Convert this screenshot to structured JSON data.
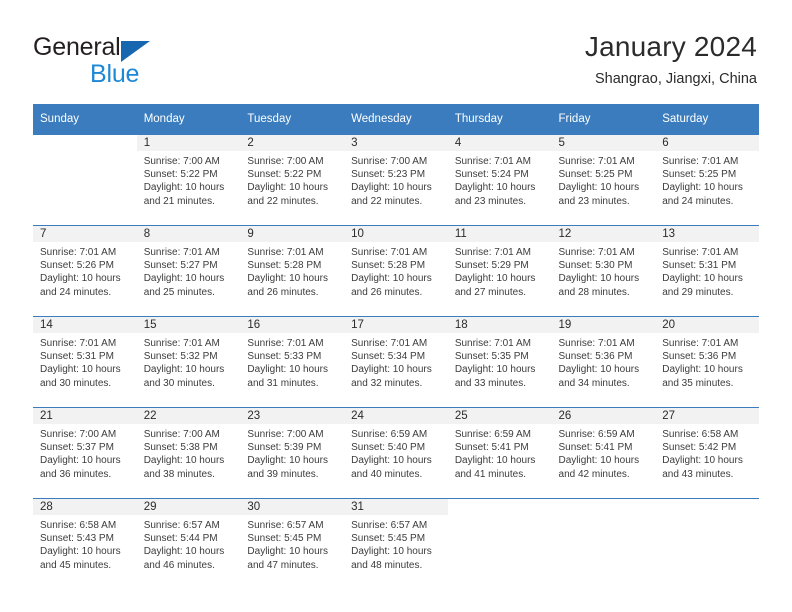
{
  "brand": {
    "name_part1": "General",
    "name_part2": "Blue",
    "triangle_icon": "triangle-icon",
    "color_dark": "#231f20",
    "color_blue": "#1e87d6",
    "color_triangle": "#1666b0"
  },
  "header": {
    "title": "January 2024",
    "subtitle": "Shangrao, Jiangxi, China"
  },
  "theme": {
    "header_bg": "#3a7cbe",
    "header_text": "#ffffff",
    "daynum_band_bg": "#f2f2f2",
    "cell_bg": "#ffffff",
    "text": "#2b2b2b"
  },
  "weekdays": [
    "Sunday",
    "Monday",
    "Tuesday",
    "Wednesday",
    "Thursday",
    "Friday",
    "Saturday"
  ],
  "weeks": [
    [
      {
        "day": "",
        "sunrise": "",
        "sunset": "",
        "daylight1": "",
        "daylight2": "",
        "blank": true
      },
      {
        "day": "1",
        "sunrise": "Sunrise: 7:00 AM",
        "sunset": "Sunset: 5:22 PM",
        "daylight1": "Daylight: 10 hours",
        "daylight2": "and 21 minutes."
      },
      {
        "day": "2",
        "sunrise": "Sunrise: 7:00 AM",
        "sunset": "Sunset: 5:22 PM",
        "daylight1": "Daylight: 10 hours",
        "daylight2": "and 22 minutes."
      },
      {
        "day": "3",
        "sunrise": "Sunrise: 7:00 AM",
        "sunset": "Sunset: 5:23 PM",
        "daylight1": "Daylight: 10 hours",
        "daylight2": "and 22 minutes."
      },
      {
        "day": "4",
        "sunrise": "Sunrise: 7:01 AM",
        "sunset": "Sunset: 5:24 PM",
        "daylight1": "Daylight: 10 hours",
        "daylight2": "and 23 minutes."
      },
      {
        "day": "5",
        "sunrise": "Sunrise: 7:01 AM",
        "sunset": "Sunset: 5:25 PM",
        "daylight1": "Daylight: 10 hours",
        "daylight2": "and 23 minutes."
      },
      {
        "day": "6",
        "sunrise": "Sunrise: 7:01 AM",
        "sunset": "Sunset: 5:25 PM",
        "daylight1": "Daylight: 10 hours",
        "daylight2": "and 24 minutes."
      }
    ],
    [
      {
        "day": "7",
        "sunrise": "Sunrise: 7:01 AM",
        "sunset": "Sunset: 5:26 PM",
        "daylight1": "Daylight: 10 hours",
        "daylight2": "and 24 minutes."
      },
      {
        "day": "8",
        "sunrise": "Sunrise: 7:01 AM",
        "sunset": "Sunset: 5:27 PM",
        "daylight1": "Daylight: 10 hours",
        "daylight2": "and 25 minutes."
      },
      {
        "day": "9",
        "sunrise": "Sunrise: 7:01 AM",
        "sunset": "Sunset: 5:28 PM",
        "daylight1": "Daylight: 10 hours",
        "daylight2": "and 26 minutes."
      },
      {
        "day": "10",
        "sunrise": "Sunrise: 7:01 AM",
        "sunset": "Sunset: 5:28 PM",
        "daylight1": "Daylight: 10 hours",
        "daylight2": "and 26 minutes."
      },
      {
        "day": "11",
        "sunrise": "Sunrise: 7:01 AM",
        "sunset": "Sunset: 5:29 PM",
        "daylight1": "Daylight: 10 hours",
        "daylight2": "and 27 minutes."
      },
      {
        "day": "12",
        "sunrise": "Sunrise: 7:01 AM",
        "sunset": "Sunset: 5:30 PM",
        "daylight1": "Daylight: 10 hours",
        "daylight2": "and 28 minutes."
      },
      {
        "day": "13",
        "sunrise": "Sunrise: 7:01 AM",
        "sunset": "Sunset: 5:31 PM",
        "daylight1": "Daylight: 10 hours",
        "daylight2": "and 29 minutes."
      }
    ],
    [
      {
        "day": "14",
        "sunrise": "Sunrise: 7:01 AM",
        "sunset": "Sunset: 5:31 PM",
        "daylight1": "Daylight: 10 hours",
        "daylight2": "and 30 minutes."
      },
      {
        "day": "15",
        "sunrise": "Sunrise: 7:01 AM",
        "sunset": "Sunset: 5:32 PM",
        "daylight1": "Daylight: 10 hours",
        "daylight2": "and 30 minutes."
      },
      {
        "day": "16",
        "sunrise": "Sunrise: 7:01 AM",
        "sunset": "Sunset: 5:33 PM",
        "daylight1": "Daylight: 10 hours",
        "daylight2": "and 31 minutes."
      },
      {
        "day": "17",
        "sunrise": "Sunrise: 7:01 AM",
        "sunset": "Sunset: 5:34 PM",
        "daylight1": "Daylight: 10 hours",
        "daylight2": "and 32 minutes."
      },
      {
        "day": "18",
        "sunrise": "Sunrise: 7:01 AM",
        "sunset": "Sunset: 5:35 PM",
        "daylight1": "Daylight: 10 hours",
        "daylight2": "and 33 minutes."
      },
      {
        "day": "19",
        "sunrise": "Sunrise: 7:01 AM",
        "sunset": "Sunset: 5:36 PM",
        "daylight1": "Daylight: 10 hours",
        "daylight2": "and 34 minutes."
      },
      {
        "day": "20",
        "sunrise": "Sunrise: 7:01 AM",
        "sunset": "Sunset: 5:36 PM",
        "daylight1": "Daylight: 10 hours",
        "daylight2": "and 35 minutes."
      }
    ],
    [
      {
        "day": "21",
        "sunrise": "Sunrise: 7:00 AM",
        "sunset": "Sunset: 5:37 PM",
        "daylight1": "Daylight: 10 hours",
        "daylight2": "and 36 minutes."
      },
      {
        "day": "22",
        "sunrise": "Sunrise: 7:00 AM",
        "sunset": "Sunset: 5:38 PM",
        "daylight1": "Daylight: 10 hours",
        "daylight2": "and 38 minutes."
      },
      {
        "day": "23",
        "sunrise": "Sunrise: 7:00 AM",
        "sunset": "Sunset: 5:39 PM",
        "daylight1": "Daylight: 10 hours",
        "daylight2": "and 39 minutes."
      },
      {
        "day": "24",
        "sunrise": "Sunrise: 6:59 AM",
        "sunset": "Sunset: 5:40 PM",
        "daylight1": "Daylight: 10 hours",
        "daylight2": "and 40 minutes."
      },
      {
        "day": "25",
        "sunrise": "Sunrise: 6:59 AM",
        "sunset": "Sunset: 5:41 PM",
        "daylight1": "Daylight: 10 hours",
        "daylight2": "and 41 minutes."
      },
      {
        "day": "26",
        "sunrise": "Sunrise: 6:59 AM",
        "sunset": "Sunset: 5:41 PM",
        "daylight1": "Daylight: 10 hours",
        "daylight2": "and 42 minutes."
      },
      {
        "day": "27",
        "sunrise": "Sunrise: 6:58 AM",
        "sunset": "Sunset: 5:42 PM",
        "daylight1": "Daylight: 10 hours",
        "daylight2": "and 43 minutes."
      }
    ],
    [
      {
        "day": "28",
        "sunrise": "Sunrise: 6:58 AM",
        "sunset": "Sunset: 5:43 PM",
        "daylight1": "Daylight: 10 hours",
        "daylight2": "and 45 minutes."
      },
      {
        "day": "29",
        "sunrise": "Sunrise: 6:57 AM",
        "sunset": "Sunset: 5:44 PM",
        "daylight1": "Daylight: 10 hours",
        "daylight2": "and 46 minutes."
      },
      {
        "day": "30",
        "sunrise": "Sunrise: 6:57 AM",
        "sunset": "Sunset: 5:45 PM",
        "daylight1": "Daylight: 10 hours",
        "daylight2": "and 47 minutes."
      },
      {
        "day": "31",
        "sunrise": "Sunrise: 6:57 AM",
        "sunset": "Sunset: 5:45 PM",
        "daylight1": "Daylight: 10 hours",
        "daylight2": "and 48 minutes."
      },
      {
        "day": "",
        "sunrise": "",
        "sunset": "",
        "daylight1": "",
        "daylight2": "",
        "blank": true
      },
      {
        "day": "",
        "sunrise": "",
        "sunset": "",
        "daylight1": "",
        "daylight2": "",
        "blank": true
      },
      {
        "day": "",
        "sunrise": "",
        "sunset": "",
        "daylight1": "",
        "daylight2": "",
        "blank": true
      }
    ]
  ]
}
